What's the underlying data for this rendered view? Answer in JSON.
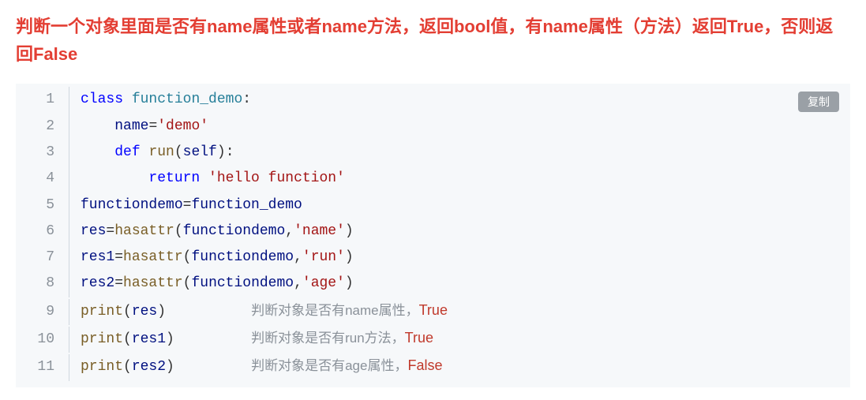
{
  "heading": "判断一个对象里面是否有name属性或者name方法，返回bool值，有name属性（方法）返回True，否则返回False",
  "copy_label": "复制",
  "code": {
    "lines": [
      {
        "n": "1"
      },
      {
        "n": "2"
      },
      {
        "n": "3"
      },
      {
        "n": "4"
      },
      {
        "n": "5"
      },
      {
        "n": "6"
      },
      {
        "n": "7"
      },
      {
        "n": "8"
      },
      {
        "n": "9"
      },
      {
        "n": "10"
      },
      {
        "n": "11"
      }
    ],
    "tokens": {
      "kw_class": "class",
      "cls_name": "function_demo",
      "colon": ":",
      "attr_name": "name",
      "eq": "=",
      "str_demo": "'demo'",
      "kw_def": "def",
      "method_run": "run",
      "lparen": "(",
      "rparen": ")",
      "self": "self",
      "kw_return": "return",
      "str_hello": "'hello function'",
      "var_functiondemo": "functiondemo",
      "var_res": "res",
      "var_res1": "res1",
      "var_res2": "res2",
      "fn_hasattr": "hasattr",
      "comma": ",",
      "str_name": "'name'",
      "str_run": "'run'",
      "str_age": "'age'",
      "fn_print": "print"
    },
    "comments": {
      "c9_text": "判断对象是否有name属性，",
      "c9_val": "True",
      "c10_text": "判断对象是否有run方法，",
      "c10_val": "True",
      "c11_text": "判断对象是否有age属性，",
      "c11_val": "False"
    }
  }
}
